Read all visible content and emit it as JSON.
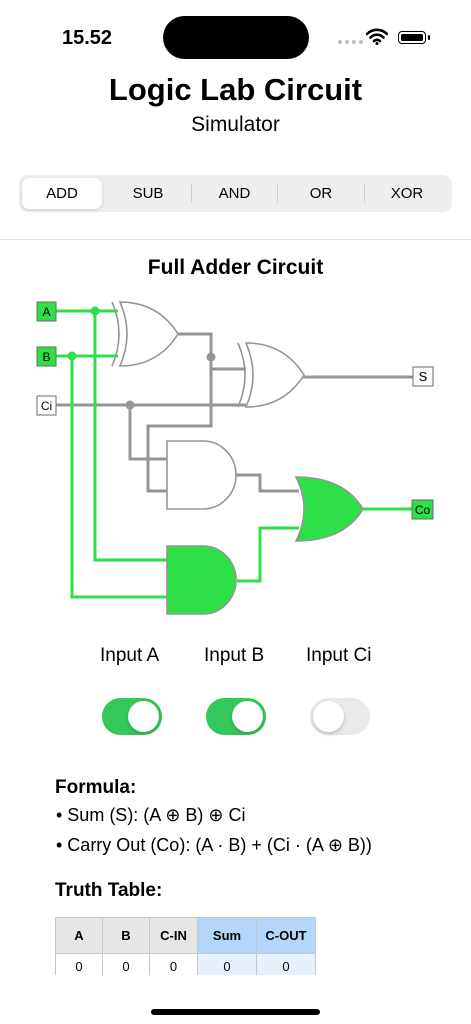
{
  "status": {
    "time": "15.52",
    "battery_level": 1.0
  },
  "header": {
    "title": "Logic Lab Circuit",
    "subtitle": "Simulator"
  },
  "tabs": [
    {
      "label": "ADD",
      "active": true
    },
    {
      "label": "SUB",
      "active": false
    },
    {
      "label": "AND",
      "active": false
    },
    {
      "label": "OR",
      "active": false
    },
    {
      "label": "XOR",
      "active": false
    }
  ],
  "circuit": {
    "title": "Full Adder Circuit",
    "nodes": {
      "a": "A",
      "b": "B",
      "ci": "Ci",
      "s": "S",
      "co": "Co"
    },
    "colors": {
      "active": "#2ee048",
      "inactive": "#959595",
      "wire_active": "#2ee048"
    }
  },
  "inputs": [
    {
      "label": "Input A",
      "on": true
    },
    {
      "label": "Input B",
      "on": true
    },
    {
      "label": "Input Ci",
      "on": false
    }
  ],
  "formula": {
    "title": "Formula:",
    "sum": "• Sum (S): (A ⊕ B) ⊕ Ci",
    "carry": "• Carry Out (Co): (A · B) + (Ci · (A ⊕ B))"
  },
  "truth_table": {
    "title": "Truth Table:",
    "columns": [
      "A",
      "B",
      "C-IN",
      "Sum",
      "C-OUT"
    ],
    "rows": [
      [
        "0",
        "0",
        "0",
        "0",
        "0"
      ]
    ]
  }
}
